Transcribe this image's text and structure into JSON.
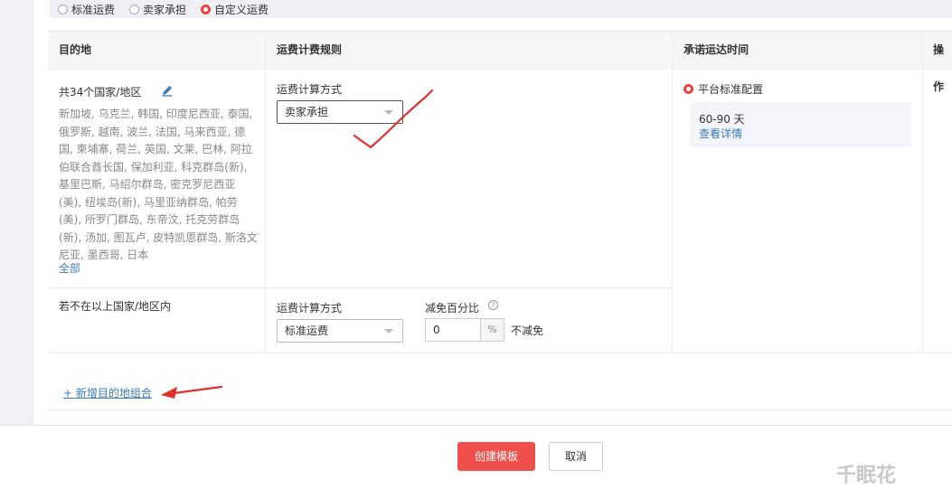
{
  "shipping_type": {
    "options": [
      "标准运费",
      "卖家承担",
      "自定义运费"
    ],
    "selected": "自定义运费"
  },
  "table": {
    "headers": {
      "destination": "目的地",
      "rule": "运费计费规则",
      "delivery_time": "承诺运达时间",
      "actions": "操作"
    },
    "row1": {
      "count_label": "共34个国家/地区",
      "countries_text": "新加坡, 乌克兰, 韩国, 印度尼西亚, 泰国, 俄罗斯, 越南, 波兰, 法国, 马来西亚, 德国, 柬埔寨, 荷兰, 英国, 文莱, 巴林, 阿拉伯联合酋长国, 保加利亚, 科克群岛(新), 基里巴斯, 马绍尔群岛, 密克罗尼西亚(美), 纽埃岛(新), 马里亚纳群岛, 帕劳(美), 所罗门群岛, 东帝汶, 托克劳群岛(新), 汤加, 图瓦卢, 皮特凯恩群岛, 斯洛文尼亚, 墨西哥, 日本",
      "all_link": "全部",
      "calc_method_label": "运费计算方式",
      "calc_method_value": "卖家承担",
      "delivery_option": "平台标准配置",
      "delivery_days": "60-90 天",
      "delivery_details_link": "查看详情"
    },
    "row2": {
      "destination_text": "若不在以上国家/地区内",
      "calc_method_label": "运费计算方式",
      "calc_method_value": "标准运费",
      "discount_label": "减免百分比",
      "discount_value": "0",
      "discount_unit": "%",
      "discount_note": "不减免"
    }
  },
  "add_destination_link": "+ 新增目的地组合",
  "footer": {
    "create_label": "创建模板",
    "cancel_label": "取消"
  },
  "watermark": "千眠花",
  "colors": {
    "accent_red": "#f0504c",
    "link_blue": "#3a7ab8",
    "annotation_red": "#e0302c"
  }
}
